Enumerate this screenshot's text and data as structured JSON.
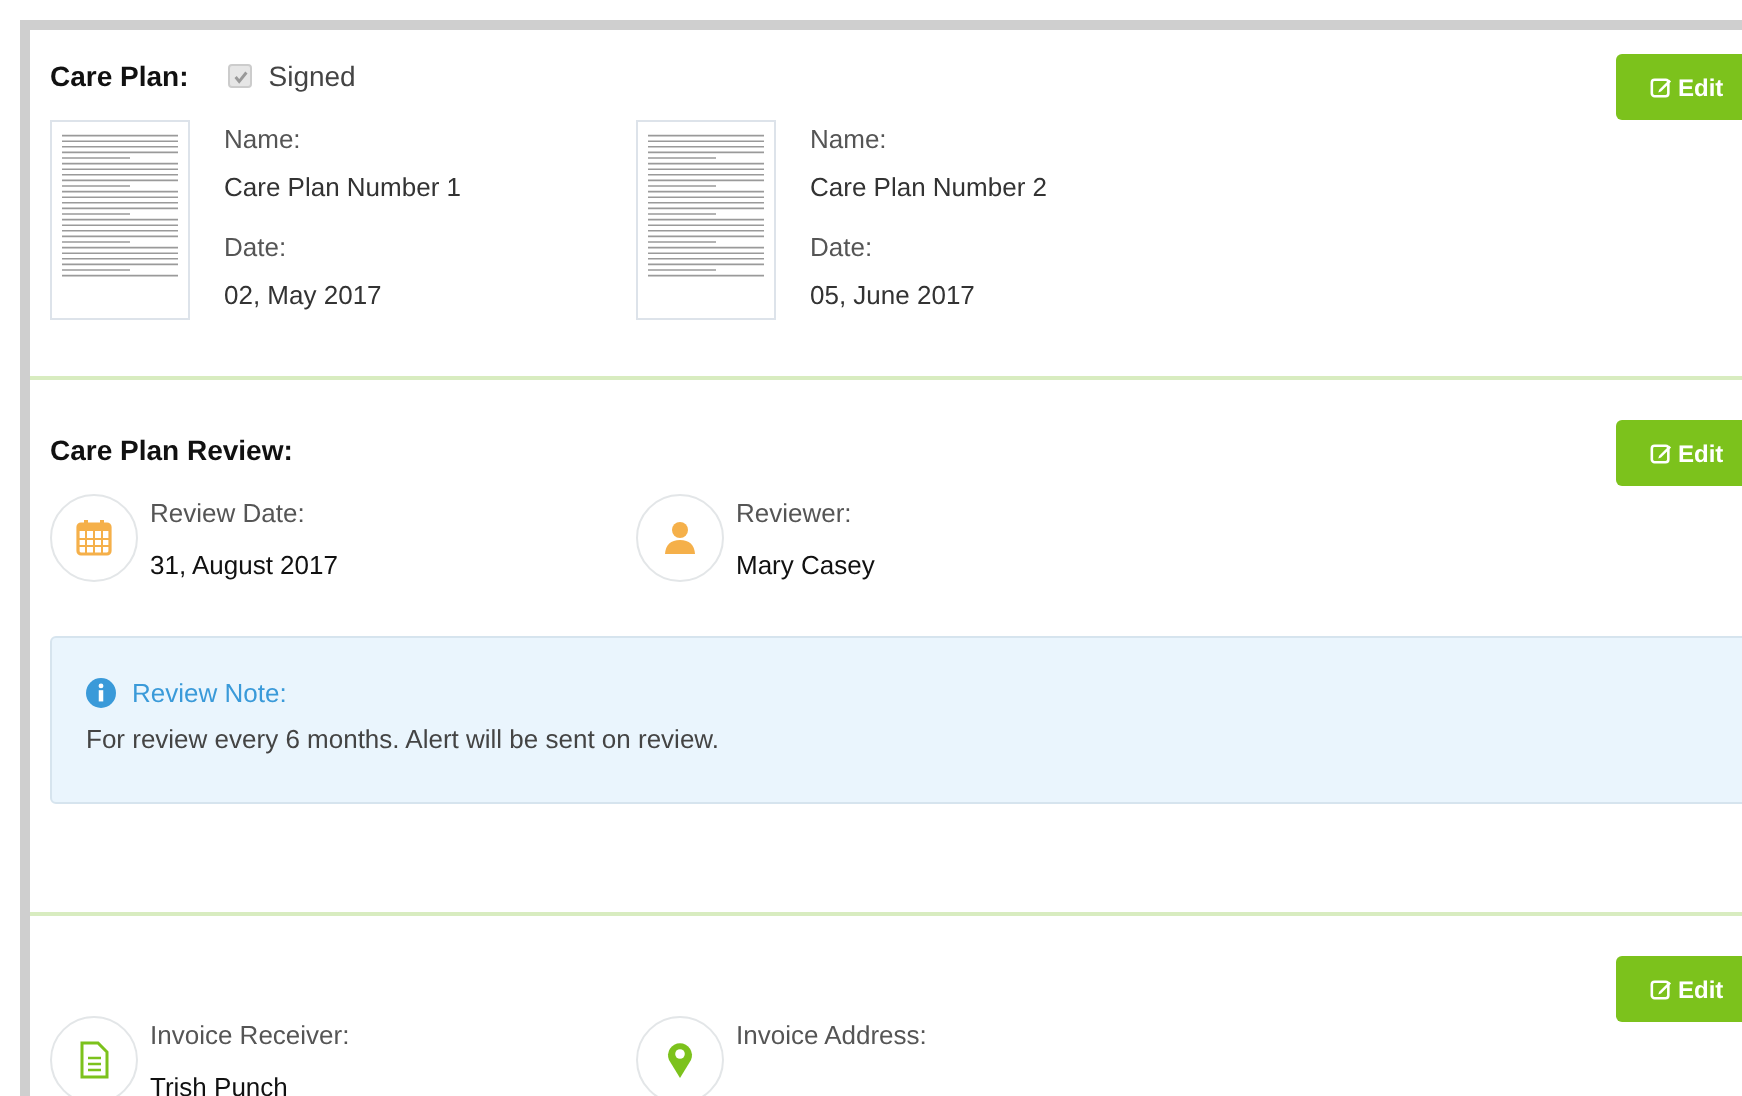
{
  "sections": [
    {
      "kind": "care_plan",
      "title": "Care Plan:",
      "signed": {
        "label": "Signed",
        "checked": true
      },
      "edit_button": "Edit",
      "documents": [
        {
          "name_label": "Name:",
          "name": "Care Plan Number 1",
          "date_label": "Date:",
          "date": "02, May 2017"
        },
        {
          "name_label": "Name:",
          "name": "Care Plan Number 2",
          "date_label": "Date:",
          "date": "05, June 2017"
        }
      ]
    },
    {
      "kind": "review",
      "title": "Care Plan Review:",
      "edit_button": "Edit",
      "items": [
        {
          "kind": "calendar",
          "label": "Review Date:",
          "value": "31, August 2017"
        },
        {
          "kind": "person",
          "label": "Reviewer:",
          "value": "Mary Casey"
        }
      ],
      "note": {
        "title": "Review Note:",
        "text": "For review every 6 months. Alert will be sent on review."
      }
    },
    {
      "kind": "invoice",
      "edit_button": "Edit",
      "items": [
        {
          "kind": "document",
          "label": "Invoice Receiver:",
          "value": "Trish Punch"
        },
        {
          "kind": "pin",
          "label": "Invoice Address:"
        }
      ]
    }
  ]
}
